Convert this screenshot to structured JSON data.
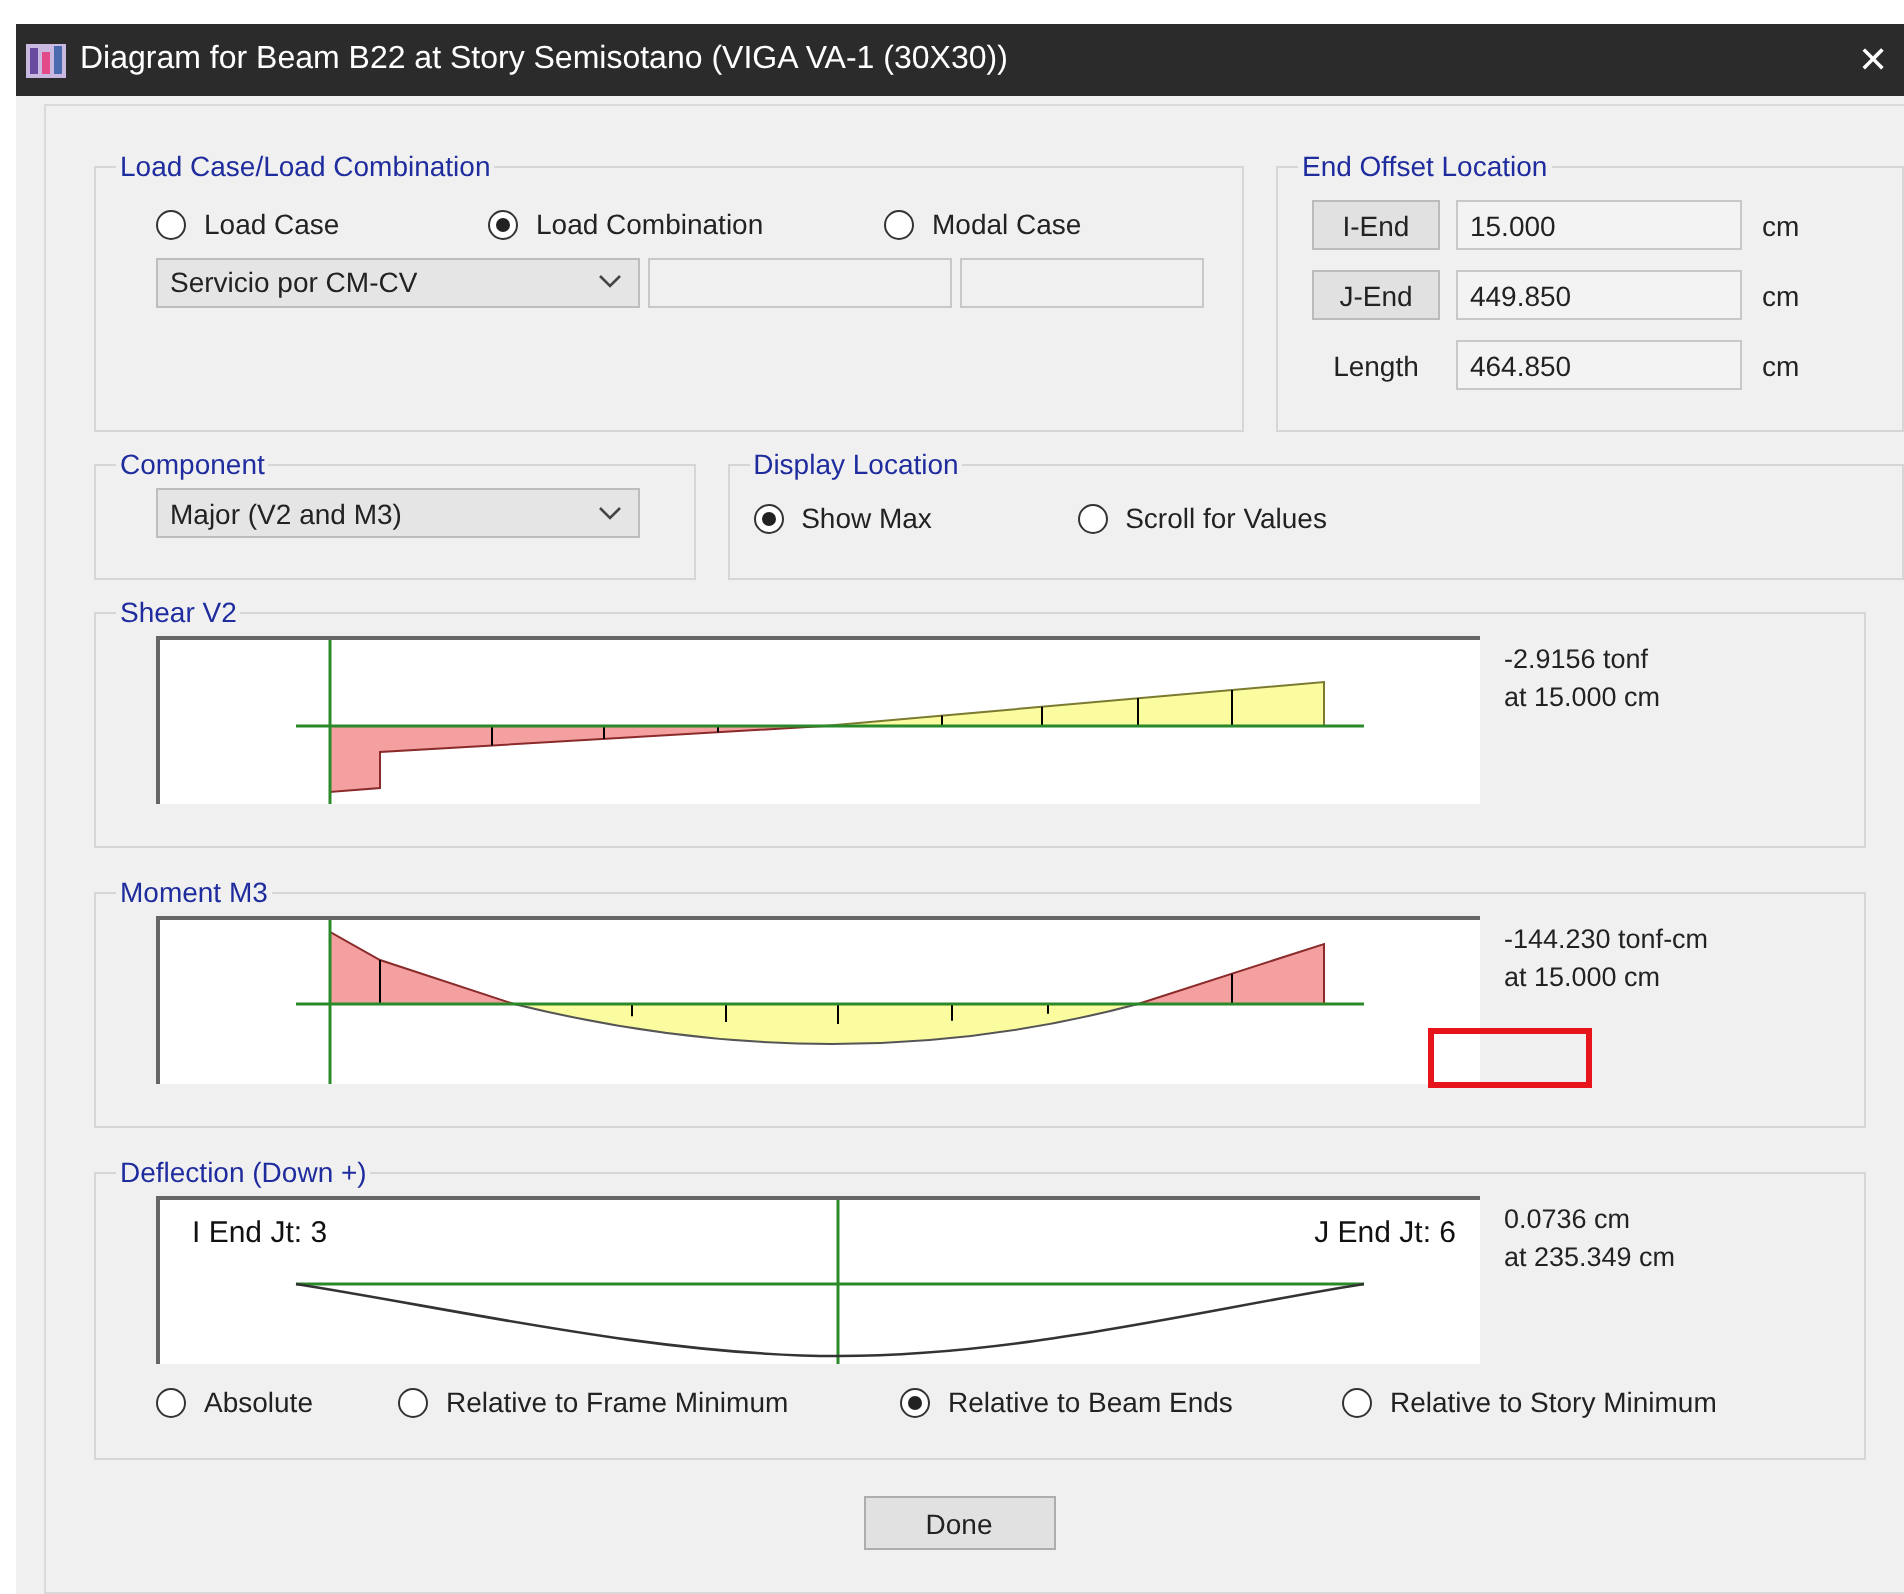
{
  "window": {
    "title": "Diagram for Beam B22 at Story Semisotano (VIGA VA-1 (30X30))",
    "close": "✕"
  },
  "load_case": {
    "title": "Load Case/Load Combination",
    "options": [
      {
        "label": "Load Case",
        "selected": false
      },
      {
        "label": "Load Combination",
        "selected": true
      },
      {
        "label": "Modal Case",
        "selected": false
      }
    ],
    "combo": "Servicio por CM-CV"
  },
  "end_offset": {
    "title": "End Offset Location",
    "rows": [
      {
        "kind": "button",
        "label": "I-End",
        "value": "15.000",
        "unit": "cm"
      },
      {
        "kind": "button",
        "label": "J-End",
        "value": "449.850",
        "unit": "cm"
      },
      {
        "kind": "label",
        "label": "Length",
        "value": "464.850",
        "unit": "cm"
      }
    ]
  },
  "component": {
    "title": "Component",
    "combo": "Major (V2 and M3)"
  },
  "display_location": {
    "title": "Display Location",
    "options": [
      {
        "label": "Show Max",
        "selected": true
      },
      {
        "label": "Scroll for Values",
        "selected": false
      }
    ]
  },
  "diagrams": [
    {
      "kind": "shear",
      "title": "Shear V2",
      "value": "-2.9156 tonf",
      "location": "at 15.000 cm"
    },
    {
      "kind": "moment",
      "title": "Moment M3",
      "value": "-144.230 tonf-cm",
      "location": "at 15.000 cm",
      "highlight_box": true
    },
    {
      "kind": "deflection",
      "title": "Deflection (Down +)",
      "value": "0.0736 cm",
      "location": "at 235.349 cm",
      "left_label": "I End Jt: 3",
      "right_label": "J End Jt: 6"
    }
  ],
  "deflection_options": [
    {
      "label": "Absolute",
      "selected": false
    },
    {
      "label": "Relative to Frame Minimum",
      "selected": false
    },
    {
      "label": "Relative to Beam Ends",
      "selected": true
    },
    {
      "label": "Relative to Story Minimum",
      "selected": false
    }
  ],
  "done_button": "Done"
}
